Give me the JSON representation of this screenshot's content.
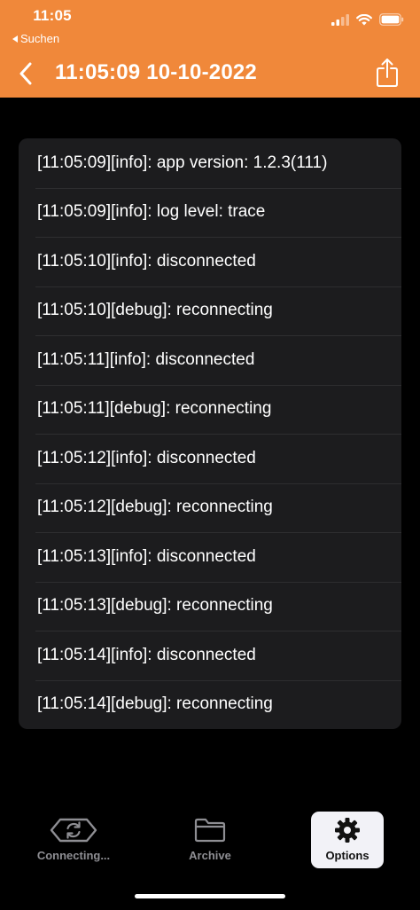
{
  "status_bar": {
    "time": "11:05",
    "back_app": "Suchen"
  },
  "nav": {
    "title": "11:05:09 10-10-2022"
  },
  "log_entries": [
    "[11:05:09][info]: app version: 1.2.3(111)",
    "[11:05:09][info]: log level: trace",
    "[11:05:10][info]: disconnected",
    "[11:05:10][debug]: reconnecting",
    "[11:05:11][info]: disconnected",
    "[11:05:11][debug]: reconnecting",
    "[11:05:12][info]: disconnected",
    "[11:05:12][debug]: reconnecting",
    "[11:05:13][info]: disconnected",
    "[11:05:13][debug]: reconnecting",
    "[11:05:14][info]: disconnected",
    "[11:05:14][debug]: reconnecting"
  ],
  "tabs": {
    "connecting": "Connecting...",
    "archive": "Archive",
    "options": "Options"
  },
  "icons": {
    "back": "chevron-left-icon",
    "share": "share-icon",
    "connecting": "refresh-icon",
    "archive": "folder-icon",
    "options": "gear-icon",
    "signal": "cellular-signal-icon",
    "wifi": "wifi-icon",
    "battery": "battery-icon"
  },
  "colors": {
    "header": "#f0883a",
    "background": "#000000",
    "card": "#1c1c1e",
    "tab_inactive": "#8e8e93",
    "tab_active_bg": "#f2f2f7"
  }
}
